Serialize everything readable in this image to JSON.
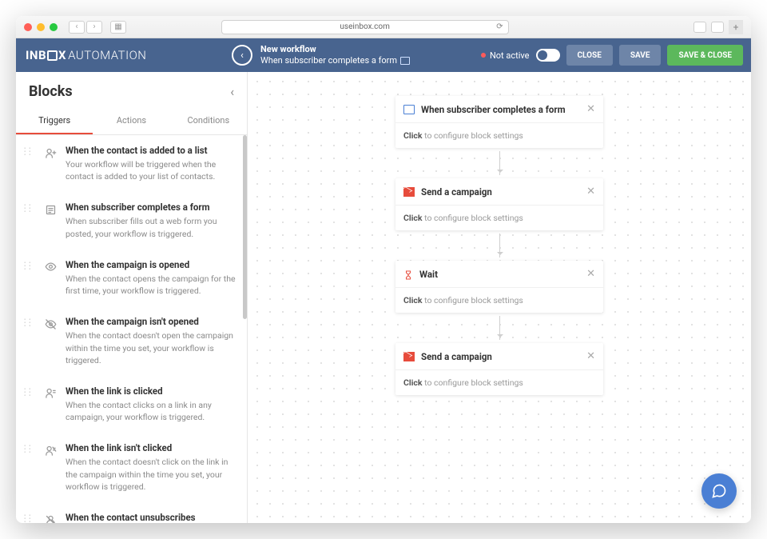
{
  "browser": {
    "url": "useinbox.com"
  },
  "logo": {
    "bold": "INB",
    "rest": "X",
    "suffix": "AUTOMATION"
  },
  "header": {
    "title": "New workflow",
    "subtitle": "When subscriber completes a form",
    "status": "Not active",
    "close": "CLOSE",
    "save": "SAVE",
    "save_close": "SAVE & CLOSE"
  },
  "sidebar": {
    "title": "Blocks",
    "tabs": [
      "Triggers",
      "Actions",
      "Conditions"
    ],
    "active_tab": 0,
    "triggers": [
      {
        "icon": "user-add",
        "title": "When the contact is added to a list",
        "desc": "Your workflow will be triggered when the contact is added to your list of contacts."
      },
      {
        "icon": "form",
        "title": "When subscriber completes a form",
        "desc": "When subscriber fills out a web form you posted, your workflow is triggered."
      },
      {
        "icon": "eye",
        "title": "When the campaign is opened",
        "desc": "When the contact opens the campaign for the first time, your workflow is triggered."
      },
      {
        "icon": "eye-off",
        "title": "When the campaign isn't opened",
        "desc": "When the contact doesn't open the campaign within the time you set, your workflow is triggered."
      },
      {
        "icon": "link",
        "title": "When the link is clicked",
        "desc": "When the contact clicks on a link in any campaign, your workflow is triggered."
      },
      {
        "icon": "link-off",
        "title": "When the link isn't clicked",
        "desc": "When the contact doesn't click on the link in the campaign within the time you set, your workflow is triggered."
      },
      {
        "icon": "unsub",
        "title": "When the contact unsubscribes",
        "desc": ""
      }
    ]
  },
  "flow": {
    "hint_bold": "Click",
    "hint_rest": " to configure block settings",
    "nodes": [
      {
        "icon": "form",
        "title": "When subscriber completes a form"
      },
      {
        "icon": "mail",
        "title": "Send a campaign"
      },
      {
        "icon": "wait",
        "title": "Wait"
      },
      {
        "icon": "mail",
        "title": "Send a campaign"
      }
    ]
  }
}
